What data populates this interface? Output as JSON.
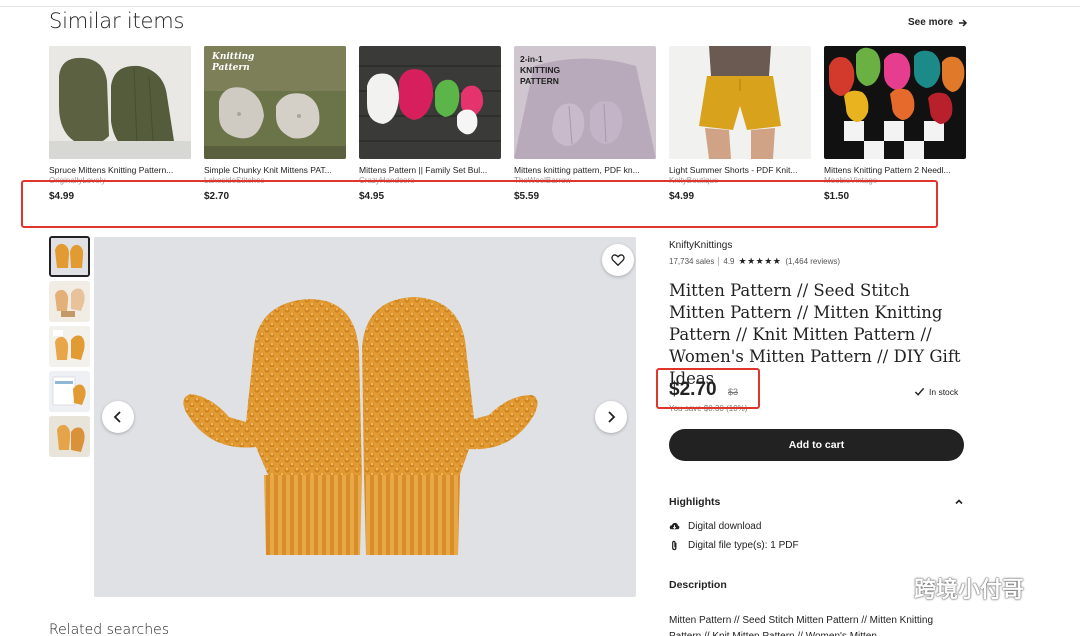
{
  "similar": {
    "title": "Similar items",
    "see_more": "See more",
    "items": [
      {
        "name": "Spruce Mittens Knitting Pattern...",
        "shop": "OriginallyLovely",
        "price": "$4.99"
      },
      {
        "name": "Simple Chunky Knit Mittens PAT...",
        "shop": "LakesideStitches",
        "price": "$2.70"
      },
      {
        "name": "Mittens Pattern || Family Set Bul...",
        "shop": "CrazyHandcore",
        "price": "$4.95"
      },
      {
        "name": "Mittens knitting pattern, PDF kn...",
        "shop": "TheWoolBarrow",
        "price": "$5.59"
      },
      {
        "name": "Light Summer Shorts - PDF Knit...",
        "shop": "KnityBoutique",
        "price": "$4.99"
      },
      {
        "name": "Mittens Knitting Pattern 2 Needl...",
        "shop": "MoobieVintage",
        "price": "$1.50"
      }
    ],
    "thumb_labels": {
      "second": "Knitting\nPattern",
      "fourth": "2-in-1\nKNITTING\nPATTERN"
    }
  },
  "listing": {
    "shop_name": "KniftyKnittings",
    "sales": "17,734 sales",
    "rating": "4.9",
    "stars": "★★★★★",
    "reviews": "(1,464 reviews)",
    "title": "Mitten Pattern // Seed Stitch Mitten Pattern // Mitten Knitting Pattern // Knit Mitten Pattern // Women's Mitten Pattern // DIY Gift Ideas",
    "price": "$2.70",
    "original_price": "$3",
    "savings": "You save $0.30 (10%)",
    "stock": "In stock",
    "add_to_cart": "Add to cart",
    "highlights_label": "Highlights",
    "highlights": [
      "Digital download",
      "Digital file type(s): 1 PDF"
    ],
    "description_label": "Description",
    "description_text": "Mitten Pattern // Seed Stitch Mitten Pattern // Mitten Knitting Pattern // Knit Mitten Pattern // Women's Mitten"
  },
  "related_searches": "Related searches",
  "watermark": "跨境小付哥",
  "colors": {
    "mitten": "#e29a32",
    "accent_red": "#e0352b",
    "button": "#222222"
  }
}
